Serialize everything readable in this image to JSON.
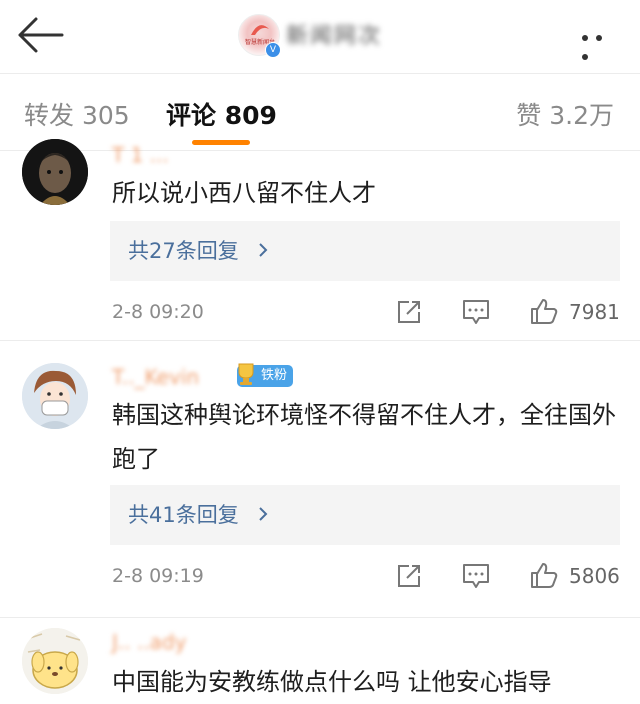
{
  "header": {
    "back_icon": "arrow-left-icon",
    "account_logo_text": "智慧新闻台",
    "account_name_blurred": "新闻网次",
    "verified_mark": "V",
    "more_icon": "more-dots-icon"
  },
  "tabs": {
    "repost_label": "转发 305",
    "comments_label": "评论 809",
    "likes_label": "赞 3.2万",
    "active_color": "#ff8200"
  },
  "comments": [
    {
      "username_blurred": "T 1 ...",
      "text": "所以说小西八留不住人才",
      "reply_label": "共27条回复",
      "time": "2-8 09:20",
      "likes": "7981"
    },
    {
      "username_blurred": "T.._Kevin",
      "fan_badge": "铁粉",
      "text": "韩国这种舆论环境怪不得留不住人才，全往国外跑了",
      "reply_label": "共41条回复",
      "time": "2-8 09:19",
      "likes": "5806"
    },
    {
      "username_blurred": "J.. ..ady",
      "text": "中国能为安教练做点什么吗 让他安心指导"
    }
  ]
}
